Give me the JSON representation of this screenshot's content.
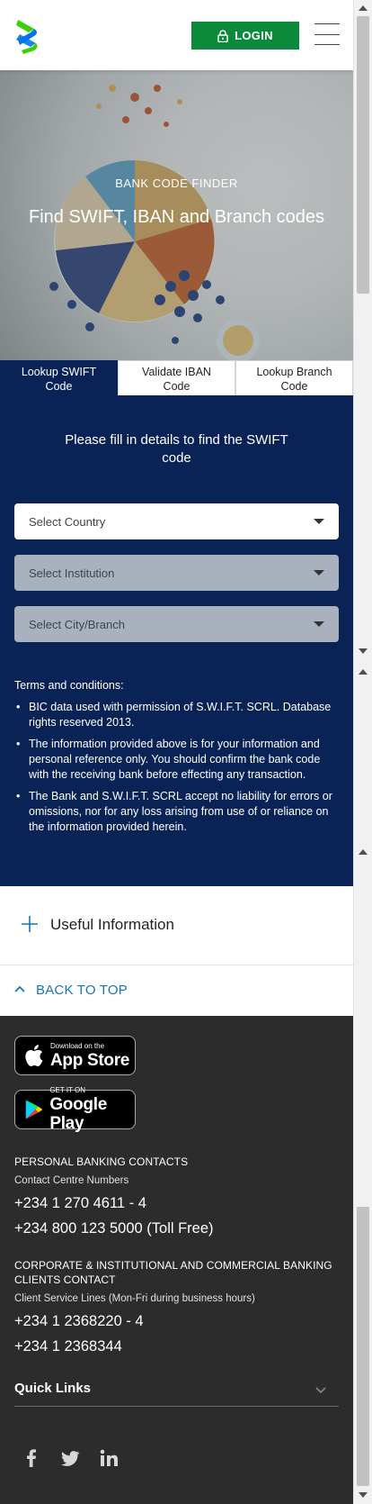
{
  "header": {
    "login_label": "LOGIN"
  },
  "hero": {
    "kicker": "BANK CODE FINDER",
    "title": "Find SWIFT, IBAN and Branch codes"
  },
  "tabs": [
    {
      "label_line1": "Lookup SWIFT",
      "label_line2": "Code",
      "active": true
    },
    {
      "label_line1": "Validate IBAN",
      "label_line2": "Code",
      "active": false
    },
    {
      "label_line1": "Lookup Branch",
      "label_line2": "Code",
      "active": false
    }
  ],
  "form": {
    "intro": "Please fill in details to find the SWIFT code",
    "country_placeholder": "Select Country",
    "institution_placeholder": "Select Institution",
    "branch_placeholder": "Select City/Branch"
  },
  "terms": {
    "title": "Terms and conditions:",
    "items": [
      "BIC data used with permission of S.W.I.F.T. SCRL. Database rights reserved 2013.",
      "The information provided above is for your information and personal reference only. You should confirm the bank code with the receiving bank before effecting any transaction.",
      "The Bank and S.W.I.F.T. SCRL accept no liability for errors or omissions, nor for any loss arising from use of or reliance on the information provided herein."
    ]
  },
  "useful": {
    "label": "Useful Information"
  },
  "back_to_top": {
    "label": "BACK TO TOP"
  },
  "footer": {
    "app_store": {
      "small": "Download on the",
      "big": "App Store"
    },
    "google_play": {
      "small": "GET IT ON",
      "big": "Google Play"
    },
    "personal": {
      "heading": "PERSONAL BANKING CONTACTS",
      "sub": "Contact Centre Numbers",
      "phones": [
        "+234 1 270 4611 - 4",
        "+234 800 123 5000 (Toll Free)"
      ]
    },
    "corporate": {
      "heading_line1": "CORPORATE & INSTITUTIONAL AND COMMERCIAL BANKING",
      "heading_line2": "CLIENTS CONTACT",
      "sub": "Client Service Lines (Mon-Fri during business hours)",
      "phones": [
        "+234 1 2368220 - 4",
        "+234 1 2368344"
      ]
    },
    "quick_links": "Quick Links",
    "social_icons": [
      "facebook-icon",
      "twitter-icon",
      "linkedin-icon"
    ]
  },
  "colors": {
    "brand_green": "#0b8a3c",
    "brand_navy": "#0a2356",
    "link_blue": "#1a74b8",
    "footer_bg": "#2c2c2c"
  }
}
